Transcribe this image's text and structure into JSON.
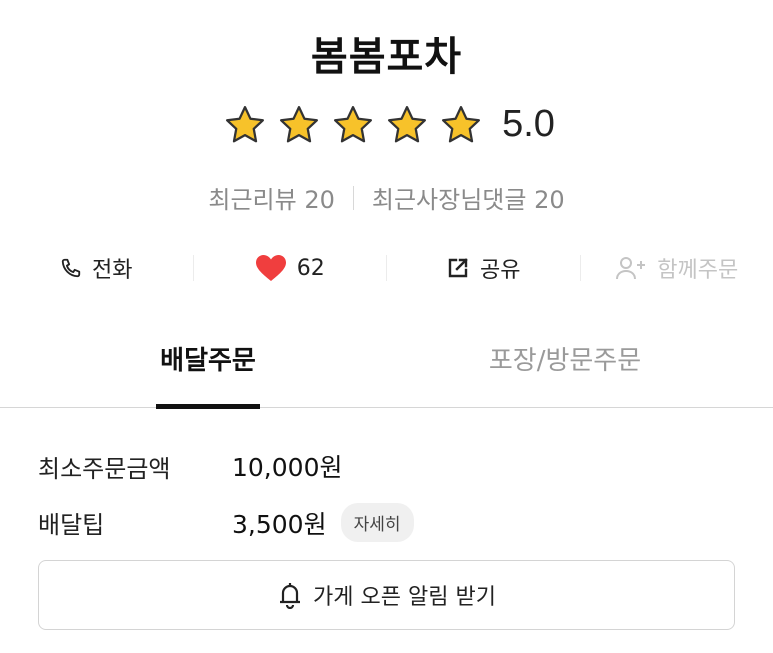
{
  "store": {
    "name": "봄봄포차",
    "rating": 5,
    "rating_text": "5.0",
    "recent_reviews": "최근리뷰 20",
    "recent_owner_replies": "최근사장님댓글 20"
  },
  "actions": {
    "call_label": "전화",
    "likes_count": "62",
    "share_label": "공유",
    "group_order_label": "함께주문"
  },
  "tabs": {
    "delivery": "배달주문",
    "pickup": "포장/방문주문"
  },
  "order_info": {
    "min_order_label": "최소주문금액",
    "min_order_value": "10,000원",
    "delivery_tip_label": "배달팁",
    "delivery_tip_value": "3,500원",
    "detail_label": "자세히"
  },
  "open_alert_label": "가게 오픈 알림 받기",
  "colors": {
    "star": "#f7c22a",
    "heart": "#f03e3e",
    "text": "#222222",
    "muted": "#8a8a8a"
  },
  "icons": [
    "star-icon",
    "phone-icon",
    "heart-icon",
    "share-icon",
    "add-user-icon",
    "bell-icon"
  ]
}
